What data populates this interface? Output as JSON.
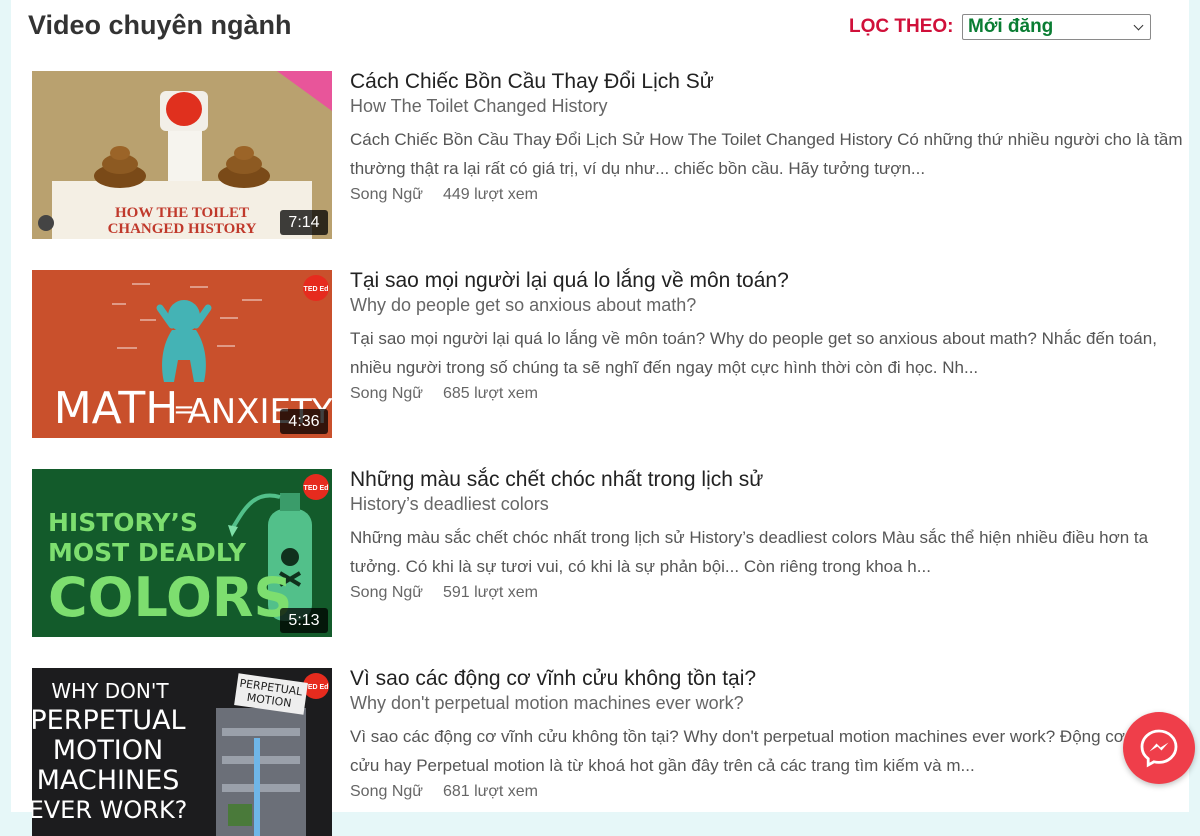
{
  "section": {
    "title": "Video chuyên ngành",
    "filter_label": "LỌC THEO:",
    "filter_value": "Mới đăng"
  },
  "videos": [
    {
      "title": "Cách Chiếc Bồn Cầu Thay Đổi Lịch Sử",
      "subtitle": "How The Toilet Changed History",
      "description": "Cách Chiếc Bồn Cầu Thay Đổi Lịch Sử How The Toilet Changed History   Có những thứ nhiều người cho là tầm thường thật ra lại rất có giá trị, ví dụ như... chiếc bồn cầu. Hãy tưởng tượn...",
      "category": "Song Ngữ",
      "views": "449 lượt xem",
      "duration": "7:14",
      "thumb_text": [
        "HOW THE TOILET",
        "CHANGED HISTORY"
      ]
    },
    {
      "title": "Tại sao mọi người lại quá lo lắng về môn toán?",
      "subtitle": "Why do people get so anxious about math?",
      "description": "Tại sao mọi người lại quá lo lắng về môn toán? Why do people get so anxious about math? Nhắc đến toán, nhiều người trong số chúng ta sẽ nghĩ đến ngay một cực hình thời còn đi học. Nh...",
      "category": "Song Ngữ",
      "views": "685 lượt xem",
      "duration": "4:36",
      "thumb_text": [
        "MATH",
        "=",
        "ANXIETY",
        "TED Ed"
      ]
    },
    {
      "title": "Những màu sắc chết chóc nhất trong lịch sử",
      "subtitle": "History’s deadliest colors",
      "description": "Những màu sắc chết chóc nhất trong lịch sử History’s deadliest colors Màu sắc thể hiện nhiều điều hơn ta tưởng. Có khi là sự tươi vui, có khi là sự phản bội... Còn riêng trong khoa h...",
      "category": "Song Ngữ",
      "views": "591 lượt xem",
      "duration": "5:13",
      "thumb_text": [
        "HISTORY’S",
        "MOST DEADLY",
        "COLORS",
        "TED Ed"
      ]
    },
    {
      "title": "Vì sao các động cơ vĩnh cửu không tồn tại?",
      "subtitle": "Why don't perpetual motion machines ever work?",
      "description": "Vì sao các động cơ vĩnh cửu không tồn tại? Why don't perpetual motion machines ever work? Động cơ vĩnh cửu hay Perpetual motion là từ khoá hot gần đây trên cả các trang tìm kiếm và m...",
      "category": "Song Ngữ",
      "views": "681 lượt xem",
      "duration": "",
      "thumb_text": [
        "WHY DON'T",
        "PERPETUAL",
        "MOTION",
        "MACHINES",
        "EVER WORK?",
        "PERPETUAL",
        "MOTION",
        "TED Ed"
      ]
    }
  ],
  "colors": {
    "filter_label": "#d0103a",
    "filter_value": "#0a7d33",
    "messenger": "#ef3e4a",
    "page_background": "#e6f7f8"
  },
  "icons": {
    "messenger": "messenger-icon",
    "dropdown": "chevron-down-icon"
  }
}
